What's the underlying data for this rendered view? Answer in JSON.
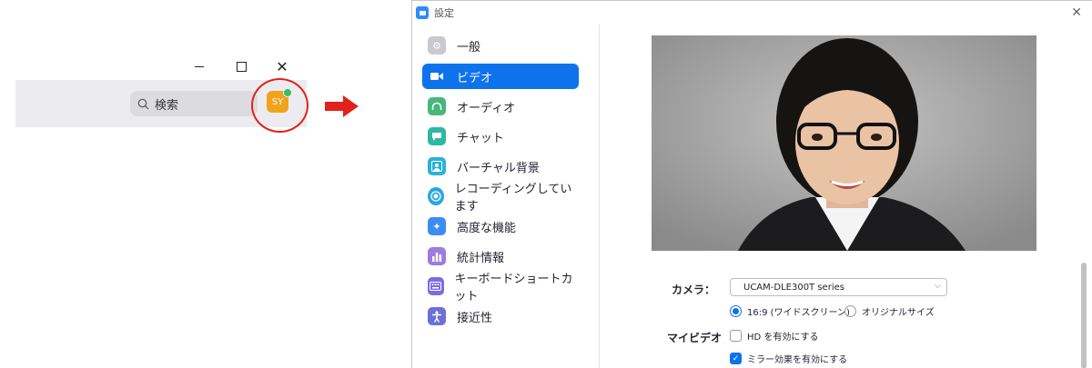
{
  "mini_window": {
    "search_placeholder": "検索",
    "avatar_initials": "SY",
    "avatar_color": "#f0a31d",
    "presence_color": "#2fc15c",
    "highlight_color": "#e3201b"
  },
  "settings": {
    "title": "設定",
    "nav": [
      {
        "label": "一般",
        "icon": "gear-icon",
        "color": "#c9c9cf"
      },
      {
        "label": "ビデオ",
        "icon": "video-camera-icon",
        "color": "#0e72ed",
        "active": true
      },
      {
        "label": "オーディオ",
        "icon": "headphones-icon",
        "color": "#48b77a"
      },
      {
        "label": "チャット",
        "icon": "chat-bubble-icon",
        "color": "#2fb7a3"
      },
      {
        "label": "バーチャル背景",
        "icon": "person-background-icon",
        "color": "#2ab2d9"
      },
      {
        "label": "レコーディングしています",
        "icon": "record-icon",
        "color": "#2aa7e0"
      },
      {
        "label": "高度な機能",
        "icon": "sparkle-icon",
        "color": "#3b8df5"
      },
      {
        "label": "統計情報",
        "icon": "bar-chart-icon",
        "color": "#9d7be0"
      },
      {
        "label": "キーボードショートカット",
        "icon": "keyboard-icon",
        "color": "#7b6ee0"
      },
      {
        "label": "接近性",
        "icon": "accessibility-icon",
        "color": "#6b6fd6"
      }
    ],
    "camera_label": "カメラ：",
    "camera_value": "UCAM-DLE300T series",
    "ratio_options": [
      "16:9 (ワイドスクリーン)",
      "オリジナルサイズ"
    ],
    "ratio_selected": "16:9 (ワイドスクリーン)",
    "my_video_label": "マイビデオ",
    "checkboxes": [
      {
        "label": "HD を有効にする",
        "checked": false
      },
      {
        "label": "ミラー効果を有効にする",
        "checked": true
      }
    ]
  }
}
